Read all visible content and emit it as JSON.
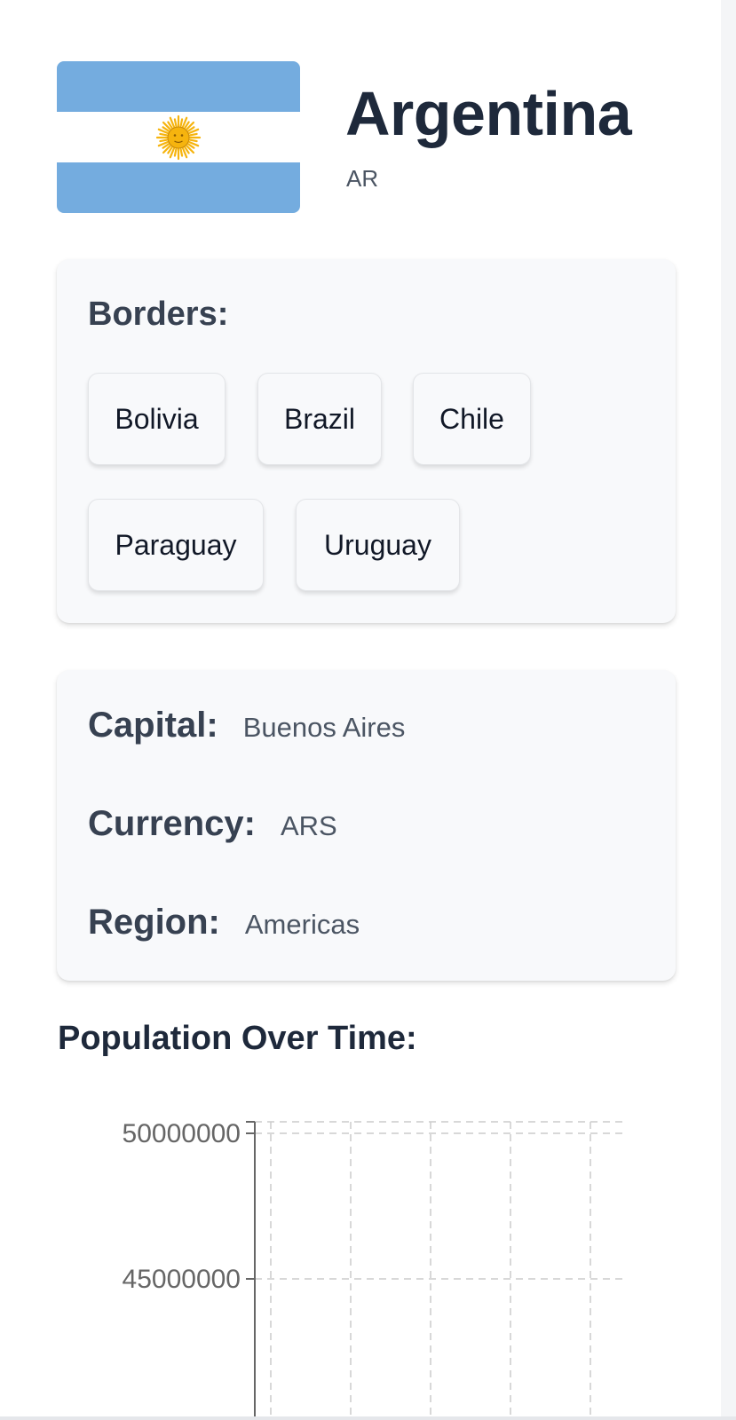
{
  "country": {
    "name": "Argentina",
    "code": "AR"
  },
  "flag": {
    "colors": {
      "sky_blue": "#74acdf",
      "white": "#ffffff",
      "sun": "#f6b40e"
    }
  },
  "borders": {
    "heading": "Borders:",
    "countries": [
      "Bolivia",
      "Brazil",
      "Chile",
      "Paraguay",
      "Uruguay"
    ]
  },
  "info": {
    "capital_label": "Capital:",
    "capital_value": "Buenos Aires",
    "currency_label": "Currency:",
    "currency_value": "ARS",
    "region_label": "Region:",
    "region_value": "Americas"
  },
  "population_section": {
    "title": "Population Over Time:"
  },
  "chart_data": {
    "type": "line",
    "title": "",
    "xlabel": "",
    "ylabel": "",
    "y_tick_labels": [
      "50000000",
      "45000000"
    ],
    "grid": true,
    "series": []
  }
}
